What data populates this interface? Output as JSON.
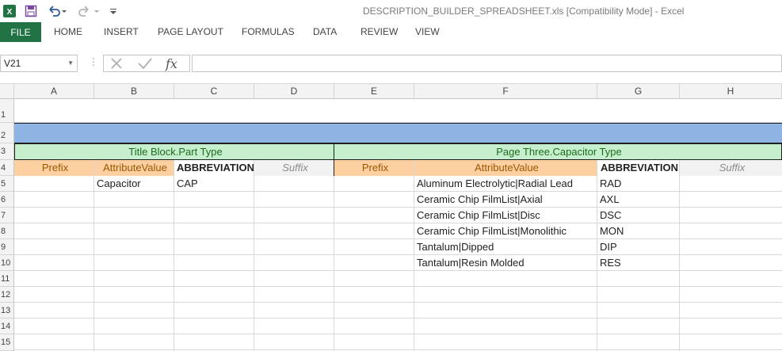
{
  "window": {
    "title": "DESCRIPTION_BUILDER_SPREADSHEET.xls  [Compatibility Mode] - Excel"
  },
  "ribbon": {
    "file_label": "FILE",
    "tabs": [
      "HOME",
      "INSERT",
      "PAGE LAYOUT",
      "FORMULAS",
      "DATA",
      "REVIEW",
      "VIEW"
    ]
  },
  "formula_bar": {
    "name_box": "V21",
    "fx_label": "fx",
    "formula": ""
  },
  "columns": [
    "A",
    "B",
    "C",
    "D",
    "E",
    "F",
    "G",
    "H"
  ],
  "rows": [
    "1",
    "2",
    "3",
    "4",
    "5",
    "6",
    "7",
    "8",
    "9",
    "10",
    "11",
    "12",
    "13",
    "14",
    "15"
  ],
  "sheet": {
    "left_header": "Title Block.Part Type",
    "right_header": "Page Three.Capacitor Type",
    "left_cols": {
      "prefix": "Prefix",
      "attr": "AttributeValue",
      "abbr": "ABBREVIATION",
      "suffix": "Suffix"
    },
    "right_cols": {
      "prefix": "Prefix",
      "attr": "AttributeValue",
      "abbr": "ABBREVIATION",
      "suffix": "Suffix"
    },
    "left_rows": [
      {
        "attr": "Capacitor",
        "abbr": "CAP"
      }
    ],
    "right_rows": [
      {
        "attr": "Aluminum Electrolytic|Radial Lead",
        "abbr": "RAD"
      },
      {
        "attr": "Ceramic Chip FilmList|Axial",
        "abbr": "AXL"
      },
      {
        "attr": "Ceramic Chip FilmList|Disc",
        "abbr": "DSC"
      },
      {
        "attr": "Ceramic Chip FilmList|Monolithic",
        "abbr": "MON"
      },
      {
        "attr": "Tantalum|Dipped",
        "abbr": "DIP"
      },
      {
        "attr": "Tantalum|Resin Molded",
        "abbr": "RES"
      }
    ]
  },
  "colors": {
    "excel_green": "#217346",
    "band_blue": "#8db4e2",
    "header_green": "#c6efce",
    "header_orange": "#fcd0a1"
  }
}
